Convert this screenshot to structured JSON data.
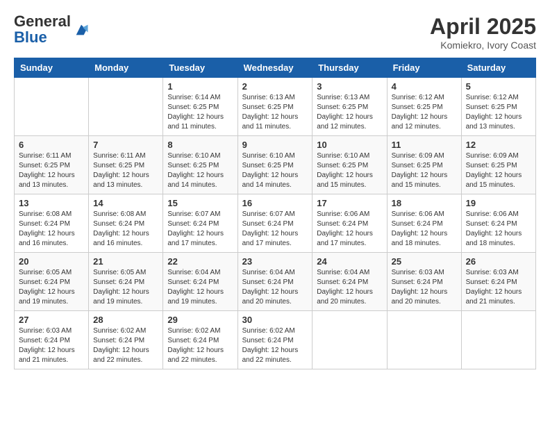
{
  "logo": {
    "general": "General",
    "blue": "Blue"
  },
  "title": "April 2025",
  "subtitle": "Komiekro, Ivory Coast",
  "days_of_week": [
    "Sunday",
    "Monday",
    "Tuesday",
    "Wednesday",
    "Thursday",
    "Friday",
    "Saturday"
  ],
  "weeks": [
    [
      {
        "day": "",
        "info": ""
      },
      {
        "day": "",
        "info": ""
      },
      {
        "day": "1",
        "info": "Sunrise: 6:14 AM\nSunset: 6:25 PM\nDaylight: 12 hours and 11 minutes."
      },
      {
        "day": "2",
        "info": "Sunrise: 6:13 AM\nSunset: 6:25 PM\nDaylight: 12 hours and 11 minutes."
      },
      {
        "day": "3",
        "info": "Sunrise: 6:13 AM\nSunset: 6:25 PM\nDaylight: 12 hours and 12 minutes."
      },
      {
        "day": "4",
        "info": "Sunrise: 6:12 AM\nSunset: 6:25 PM\nDaylight: 12 hours and 12 minutes."
      },
      {
        "day": "5",
        "info": "Sunrise: 6:12 AM\nSunset: 6:25 PM\nDaylight: 12 hours and 13 minutes."
      }
    ],
    [
      {
        "day": "6",
        "info": "Sunrise: 6:11 AM\nSunset: 6:25 PM\nDaylight: 12 hours and 13 minutes."
      },
      {
        "day": "7",
        "info": "Sunrise: 6:11 AM\nSunset: 6:25 PM\nDaylight: 12 hours and 13 minutes."
      },
      {
        "day": "8",
        "info": "Sunrise: 6:10 AM\nSunset: 6:25 PM\nDaylight: 12 hours and 14 minutes."
      },
      {
        "day": "9",
        "info": "Sunrise: 6:10 AM\nSunset: 6:25 PM\nDaylight: 12 hours and 14 minutes."
      },
      {
        "day": "10",
        "info": "Sunrise: 6:10 AM\nSunset: 6:25 PM\nDaylight: 12 hours and 15 minutes."
      },
      {
        "day": "11",
        "info": "Sunrise: 6:09 AM\nSunset: 6:25 PM\nDaylight: 12 hours and 15 minutes."
      },
      {
        "day": "12",
        "info": "Sunrise: 6:09 AM\nSunset: 6:25 PM\nDaylight: 12 hours and 15 minutes."
      }
    ],
    [
      {
        "day": "13",
        "info": "Sunrise: 6:08 AM\nSunset: 6:24 PM\nDaylight: 12 hours and 16 minutes."
      },
      {
        "day": "14",
        "info": "Sunrise: 6:08 AM\nSunset: 6:24 PM\nDaylight: 12 hours and 16 minutes."
      },
      {
        "day": "15",
        "info": "Sunrise: 6:07 AM\nSunset: 6:24 PM\nDaylight: 12 hours and 17 minutes."
      },
      {
        "day": "16",
        "info": "Sunrise: 6:07 AM\nSunset: 6:24 PM\nDaylight: 12 hours and 17 minutes."
      },
      {
        "day": "17",
        "info": "Sunrise: 6:06 AM\nSunset: 6:24 PM\nDaylight: 12 hours and 17 minutes."
      },
      {
        "day": "18",
        "info": "Sunrise: 6:06 AM\nSunset: 6:24 PM\nDaylight: 12 hours and 18 minutes."
      },
      {
        "day": "19",
        "info": "Sunrise: 6:06 AM\nSunset: 6:24 PM\nDaylight: 12 hours and 18 minutes."
      }
    ],
    [
      {
        "day": "20",
        "info": "Sunrise: 6:05 AM\nSunset: 6:24 PM\nDaylight: 12 hours and 19 minutes."
      },
      {
        "day": "21",
        "info": "Sunrise: 6:05 AM\nSunset: 6:24 PM\nDaylight: 12 hours and 19 minutes."
      },
      {
        "day": "22",
        "info": "Sunrise: 6:04 AM\nSunset: 6:24 PM\nDaylight: 12 hours and 19 minutes."
      },
      {
        "day": "23",
        "info": "Sunrise: 6:04 AM\nSunset: 6:24 PM\nDaylight: 12 hours and 20 minutes."
      },
      {
        "day": "24",
        "info": "Sunrise: 6:04 AM\nSunset: 6:24 PM\nDaylight: 12 hours and 20 minutes."
      },
      {
        "day": "25",
        "info": "Sunrise: 6:03 AM\nSunset: 6:24 PM\nDaylight: 12 hours and 20 minutes."
      },
      {
        "day": "26",
        "info": "Sunrise: 6:03 AM\nSunset: 6:24 PM\nDaylight: 12 hours and 21 minutes."
      }
    ],
    [
      {
        "day": "27",
        "info": "Sunrise: 6:03 AM\nSunset: 6:24 PM\nDaylight: 12 hours and 21 minutes."
      },
      {
        "day": "28",
        "info": "Sunrise: 6:02 AM\nSunset: 6:24 PM\nDaylight: 12 hours and 22 minutes."
      },
      {
        "day": "29",
        "info": "Sunrise: 6:02 AM\nSunset: 6:24 PM\nDaylight: 12 hours and 22 minutes."
      },
      {
        "day": "30",
        "info": "Sunrise: 6:02 AM\nSunset: 6:24 PM\nDaylight: 12 hours and 22 minutes."
      },
      {
        "day": "",
        "info": ""
      },
      {
        "day": "",
        "info": ""
      },
      {
        "day": "",
        "info": ""
      }
    ]
  ]
}
